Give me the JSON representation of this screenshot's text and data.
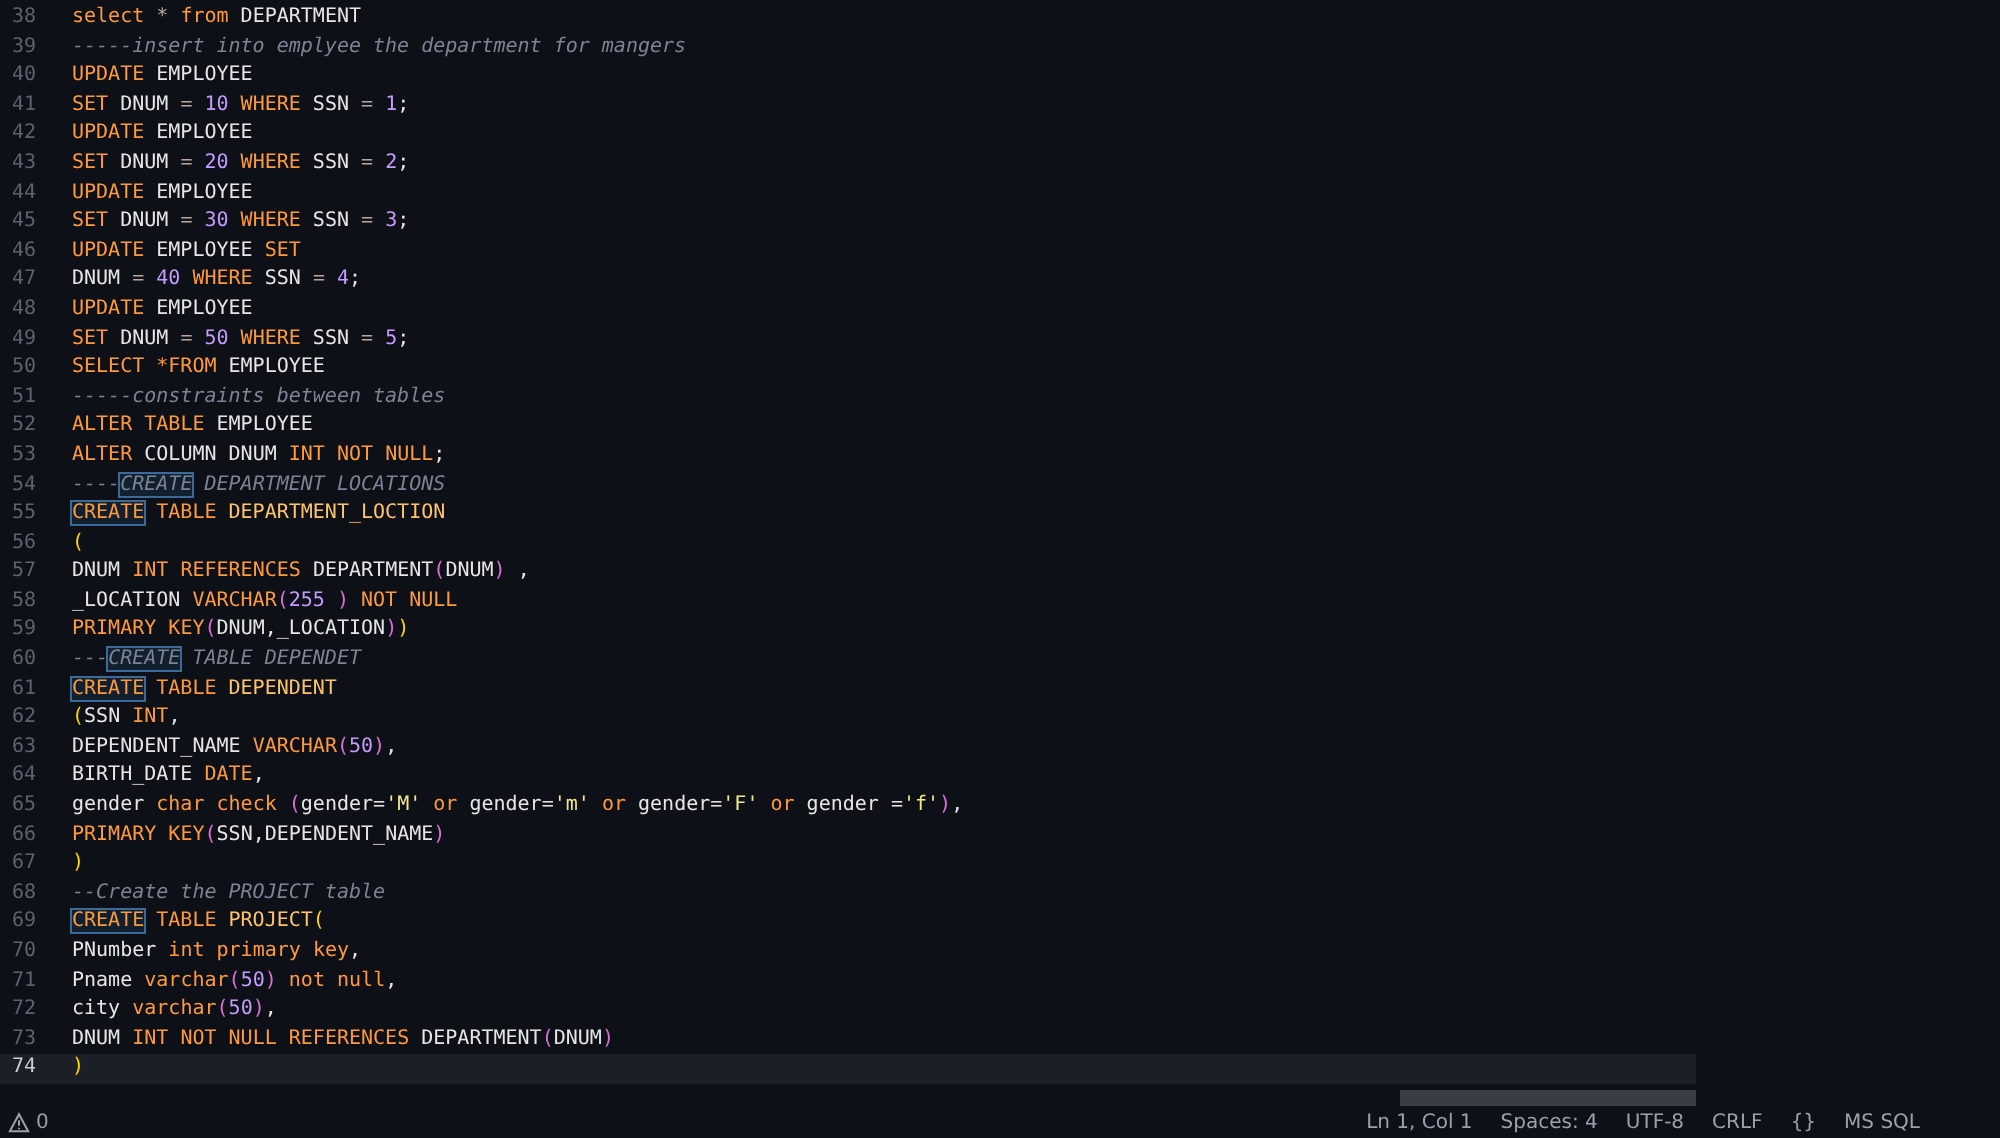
{
  "editor": {
    "lines": [
      {
        "number": "38",
        "current": false,
        "tokens": [
          {
            "text": "select",
            "kind": "kw"
          },
          {
            "text": " *",
            "kind": "op"
          },
          {
            "text": " from",
            "kind": "kw"
          },
          {
            "text": " DEPARTMENT",
            "kind": "id"
          }
        ]
      },
      {
        "number": "39",
        "current": false,
        "tokens": [
          {
            "text": "-----insert into emplyee the department for mangers",
            "kind": "cm"
          }
        ]
      },
      {
        "number": "40",
        "current": false,
        "tokens": [
          {
            "text": "UPDATE",
            "kind": "kw"
          },
          {
            "text": " EMPLOYEE",
            "kind": "id"
          }
        ]
      },
      {
        "number": "41",
        "current": false,
        "tokens": [
          {
            "text": "SET",
            "kind": "kw"
          },
          {
            "text": " DNUM",
            "kind": "id"
          },
          {
            "text": " =",
            "kind": "op"
          },
          {
            "text": " 10",
            "kind": "num"
          },
          {
            "text": " WHERE",
            "kind": "kw"
          },
          {
            "text": " SSN",
            "kind": "id"
          },
          {
            "text": " =",
            "kind": "op"
          },
          {
            "text": " 1",
            "kind": "num"
          },
          {
            "text": ";",
            "kind": "id"
          }
        ]
      },
      {
        "number": "42",
        "current": false,
        "tokens": [
          {
            "text": "UPDATE",
            "kind": "kw"
          },
          {
            "text": " EMPLOYEE",
            "kind": "id"
          }
        ]
      },
      {
        "number": "43",
        "current": false,
        "tokens": [
          {
            "text": "SET",
            "kind": "kw"
          },
          {
            "text": " DNUM",
            "kind": "id"
          },
          {
            "text": " =",
            "kind": "op"
          },
          {
            "text": " 20",
            "kind": "num"
          },
          {
            "text": " WHERE",
            "kind": "kw"
          },
          {
            "text": " SSN",
            "kind": "id"
          },
          {
            "text": " =",
            "kind": "op"
          },
          {
            "text": " 2",
            "kind": "num"
          },
          {
            "text": ";",
            "kind": "id"
          }
        ]
      },
      {
        "number": "44",
        "current": false,
        "tokens": [
          {
            "text": "UPDATE",
            "kind": "kw"
          },
          {
            "text": " EMPLOYEE",
            "kind": "id"
          }
        ]
      },
      {
        "number": "45",
        "current": false,
        "tokens": [
          {
            "text": "SET",
            "kind": "kw"
          },
          {
            "text": " DNUM",
            "kind": "id"
          },
          {
            "text": " =",
            "kind": "op"
          },
          {
            "text": " 30",
            "kind": "num"
          },
          {
            "text": " WHERE",
            "kind": "kw"
          },
          {
            "text": " SSN",
            "kind": "id"
          },
          {
            "text": " =",
            "kind": "op"
          },
          {
            "text": " 3",
            "kind": "num"
          },
          {
            "text": ";",
            "kind": "id"
          }
        ]
      },
      {
        "number": "46",
        "current": false,
        "tokens": [
          {
            "text": "UPDATE",
            "kind": "kw"
          },
          {
            "text": " EMPLOYEE",
            "kind": "id"
          },
          {
            "text": " SET",
            "kind": "kw"
          }
        ]
      },
      {
        "number": "47",
        "current": false,
        "tokens": [
          {
            "text": "DNUM",
            "kind": "id"
          },
          {
            "text": " =",
            "kind": "op"
          },
          {
            "text": " 40",
            "kind": "num"
          },
          {
            "text": " WHERE",
            "kind": "kw"
          },
          {
            "text": " SSN",
            "kind": "id"
          },
          {
            "text": " =",
            "kind": "op"
          },
          {
            "text": " 4",
            "kind": "num"
          },
          {
            "text": ";",
            "kind": "id"
          }
        ]
      },
      {
        "number": "48",
        "current": false,
        "tokens": [
          {
            "text": "UPDATE",
            "kind": "kw"
          },
          {
            "text": " EMPLOYEE",
            "kind": "id"
          }
        ]
      },
      {
        "number": "49",
        "current": false,
        "tokens": [
          {
            "text": "SET",
            "kind": "kw"
          },
          {
            "text": " DNUM",
            "kind": "id"
          },
          {
            "text": " =",
            "kind": "op"
          },
          {
            "text": " 50",
            "kind": "num"
          },
          {
            "text": " WHERE",
            "kind": "kw"
          },
          {
            "text": " SSN",
            "kind": "id"
          },
          {
            "text": " =",
            "kind": "op"
          },
          {
            "text": " 5",
            "kind": "num"
          },
          {
            "text": ";",
            "kind": "id"
          }
        ]
      },
      {
        "number": "50",
        "current": false,
        "tokens": [
          {
            "text": "SELECT",
            "kind": "kw"
          },
          {
            "text": " *FROM",
            "kind": "kw"
          },
          {
            "text": " EMPLOYEE",
            "kind": "id"
          }
        ]
      },
      {
        "number": "51",
        "current": false,
        "tokens": [
          {
            "text": "-----constraints between tables",
            "kind": "cm"
          }
        ]
      },
      {
        "number": "52",
        "current": false,
        "tokens": [
          {
            "text": "ALTER",
            "kind": "kw"
          },
          {
            "text": " TABLE",
            "kind": "kw"
          },
          {
            "text": " EMPLOYEE",
            "kind": "id"
          }
        ]
      },
      {
        "number": "53",
        "current": false,
        "tokens": [
          {
            "text": "ALTER",
            "kind": "kw"
          },
          {
            "text": " COLUMN",
            "kind": "id"
          },
          {
            "text": " DNUM",
            "kind": "id"
          },
          {
            "text": " INT",
            "kind": "kw"
          },
          {
            "text": " NOT",
            "kind": "kw"
          },
          {
            "text": " NULL",
            "kind": "kw"
          },
          {
            "text": ";",
            "kind": "id"
          }
        ]
      },
      {
        "number": "54",
        "current": false,
        "tokens": [
          {
            "text": "----",
            "kind": "cm"
          },
          {
            "text": "CREATE",
            "kind": "cm-match"
          },
          {
            "text": " DEPARTMENT LOCATIONS",
            "kind": "cm"
          }
        ]
      },
      {
        "number": "55",
        "current": false,
        "tokens": [
          {
            "text": "CREATE",
            "kind": "match"
          },
          {
            "text": " TABLE",
            "kind": "kw"
          },
          {
            "text": " DEPARTMENT_LOCTION",
            "kind": "name"
          }
        ]
      },
      {
        "number": "56",
        "current": false,
        "tokens": [
          {
            "text": "(",
            "kind": "p1"
          }
        ]
      },
      {
        "number": "57",
        "current": false,
        "tokens": [
          {
            "text": "DNUM",
            "kind": "id"
          },
          {
            "text": " INT",
            "kind": "kw"
          },
          {
            "text": " REFERENCES",
            "kind": "kw"
          },
          {
            "text": " DEPARTMENT",
            "kind": "id"
          },
          {
            "text": "(",
            "kind": "p2"
          },
          {
            "text": "DNUM",
            "kind": "id"
          },
          {
            "text": ")",
            "kind": "p2"
          },
          {
            "text": " ,",
            "kind": "id"
          }
        ]
      },
      {
        "number": "58",
        "current": false,
        "tokens": [
          {
            "text": "_LOCATION",
            "kind": "id"
          },
          {
            "text": " VARCHAR",
            "kind": "kw"
          },
          {
            "text": "(",
            "kind": "p2"
          },
          {
            "text": "255",
            "kind": "num"
          },
          {
            "text": " )",
            "kind": "p2"
          },
          {
            "text": " NOT",
            "kind": "kw"
          },
          {
            "text": " NULL",
            "kind": "kw"
          }
        ]
      },
      {
        "number": "59",
        "current": false,
        "tokens": [
          {
            "text": "PRIMARY",
            "kind": "kw"
          },
          {
            "text": " KEY",
            "kind": "kw"
          },
          {
            "text": "(",
            "kind": "p2"
          },
          {
            "text": "DNUM,_LOCATION",
            "kind": "id"
          },
          {
            "text": ")",
            "kind": "p2"
          },
          {
            "text": ")",
            "kind": "p1"
          }
        ]
      },
      {
        "number": "60",
        "current": false,
        "tokens": [
          {
            "text": "---",
            "kind": "cm"
          },
          {
            "text": "CREATE",
            "kind": "cm-match"
          },
          {
            "text": " TABLE DEPENDET",
            "kind": "cm"
          }
        ]
      },
      {
        "number": "61",
        "current": false,
        "tokens": [
          {
            "text": "CREATE",
            "kind": "match"
          },
          {
            "text": " TABLE",
            "kind": "kw"
          },
          {
            "text": " DEPENDENT",
            "kind": "name"
          }
        ]
      },
      {
        "number": "62",
        "current": false,
        "tokens": [
          {
            "text": "(",
            "kind": "p1"
          },
          {
            "text": "SSN",
            "kind": "id"
          },
          {
            "text": " INT",
            "kind": "kw"
          },
          {
            "text": ",",
            "kind": "id"
          }
        ]
      },
      {
        "number": "63",
        "current": false,
        "tokens": [
          {
            "text": "DEPENDENT_NAME",
            "kind": "id"
          },
          {
            "text": " VARCHAR",
            "kind": "kw"
          },
          {
            "text": "(",
            "kind": "p2"
          },
          {
            "text": "50",
            "kind": "num"
          },
          {
            "text": ")",
            "kind": "p2"
          },
          {
            "text": ",",
            "kind": "id"
          }
        ]
      },
      {
        "number": "64",
        "current": false,
        "tokens": [
          {
            "text": "BIRTH_DATE",
            "kind": "id"
          },
          {
            "text": " DATE",
            "kind": "kw"
          },
          {
            "text": ",",
            "kind": "id"
          }
        ]
      },
      {
        "number": "65",
        "current": false,
        "tokens": [
          {
            "text": "gender",
            "kind": "id"
          },
          {
            "text": " char",
            "kind": "kw"
          },
          {
            "text": " check",
            "kind": "kw"
          },
          {
            "text": " (",
            "kind": "p2"
          },
          {
            "text": "gender=",
            "kind": "id"
          },
          {
            "text": "'M'",
            "kind": "str"
          },
          {
            "text": " or",
            "kind": "kw"
          },
          {
            "text": " gender=",
            "kind": "id"
          },
          {
            "text": "'m'",
            "kind": "str"
          },
          {
            "text": " or",
            "kind": "kw"
          },
          {
            "text": " gender=",
            "kind": "id"
          },
          {
            "text": "'F'",
            "kind": "str"
          },
          {
            "text": " or",
            "kind": "kw"
          },
          {
            "text": " gender =",
            "kind": "id"
          },
          {
            "text": "'f'",
            "kind": "str"
          },
          {
            "text": ")",
            "kind": "p2"
          },
          {
            "text": ",",
            "kind": "id"
          }
        ]
      },
      {
        "number": "66",
        "current": false,
        "tokens": [
          {
            "text": "PRIMARY",
            "kind": "kw"
          },
          {
            "text": " KEY",
            "kind": "kw"
          },
          {
            "text": "(",
            "kind": "p2"
          },
          {
            "text": "SSN,DEPENDENT_NAME",
            "kind": "id"
          },
          {
            "text": ")",
            "kind": "p2"
          }
        ]
      },
      {
        "number": "67",
        "current": false,
        "tokens": [
          {
            "text": ")",
            "kind": "p1"
          }
        ]
      },
      {
        "number": "68",
        "current": false,
        "tokens": [
          {
            "text": "--Create the PROJECT table",
            "kind": "cm"
          }
        ]
      },
      {
        "number": "69",
        "current": false,
        "tokens": [
          {
            "text": "CREATE",
            "kind": "match"
          },
          {
            "text": " TABLE",
            "kind": "kw"
          },
          {
            "text": " PROJECT",
            "kind": "name"
          },
          {
            "text": "(",
            "kind": "p1"
          }
        ]
      },
      {
        "number": "70",
        "current": false,
        "tokens": [
          {
            "text": "PNumber",
            "kind": "id"
          },
          {
            "text": " int",
            "kind": "kw"
          },
          {
            "text": " primary",
            "kind": "kw"
          },
          {
            "text": " key",
            "kind": "kw"
          },
          {
            "text": ",",
            "kind": "id"
          }
        ]
      },
      {
        "number": "71",
        "current": false,
        "tokens": [
          {
            "text": "Pname",
            "kind": "id"
          },
          {
            "text": " varchar",
            "kind": "kw"
          },
          {
            "text": "(",
            "kind": "p2"
          },
          {
            "text": "50",
            "kind": "num"
          },
          {
            "text": ")",
            "kind": "p2"
          },
          {
            "text": " not",
            "kind": "kw"
          },
          {
            "text": " null",
            "kind": "kw"
          },
          {
            "text": ",",
            "kind": "id"
          }
        ]
      },
      {
        "number": "72",
        "current": false,
        "tokens": [
          {
            "text": "city",
            "kind": "id"
          },
          {
            "text": " varchar",
            "kind": "kw"
          },
          {
            "text": "(",
            "kind": "p2"
          },
          {
            "text": "50",
            "kind": "num"
          },
          {
            "text": ")",
            "kind": "p2"
          },
          {
            "text": ",",
            "kind": "id"
          }
        ]
      },
      {
        "number": "73",
        "current": false,
        "tokens": [
          {
            "text": "DNUM",
            "kind": "id"
          },
          {
            "text": " INT NOT NULL REFERENCES",
            "kind": "kw"
          },
          {
            "text": " DEPARTMENT",
            "kind": "id"
          },
          {
            "text": "(",
            "kind": "p2"
          },
          {
            "text": "DNUM",
            "kind": "id"
          },
          {
            "text": ")",
            "kind": "p2"
          }
        ]
      },
      {
        "number": "74",
        "current": true,
        "tokens": [
          {
            "text": ")",
            "kind": "p1"
          }
        ]
      }
    ]
  },
  "status_bar": {
    "warnings": "0",
    "items": [
      {
        "text": "Ln 1, Col 1"
      },
      {
        "text": "Spaces: 4"
      },
      {
        "text": "UTF-8"
      },
      {
        "text": "CRLF"
      },
      {
        "text": "{}"
      },
      {
        "text": "MS SQL"
      }
    ]
  }
}
